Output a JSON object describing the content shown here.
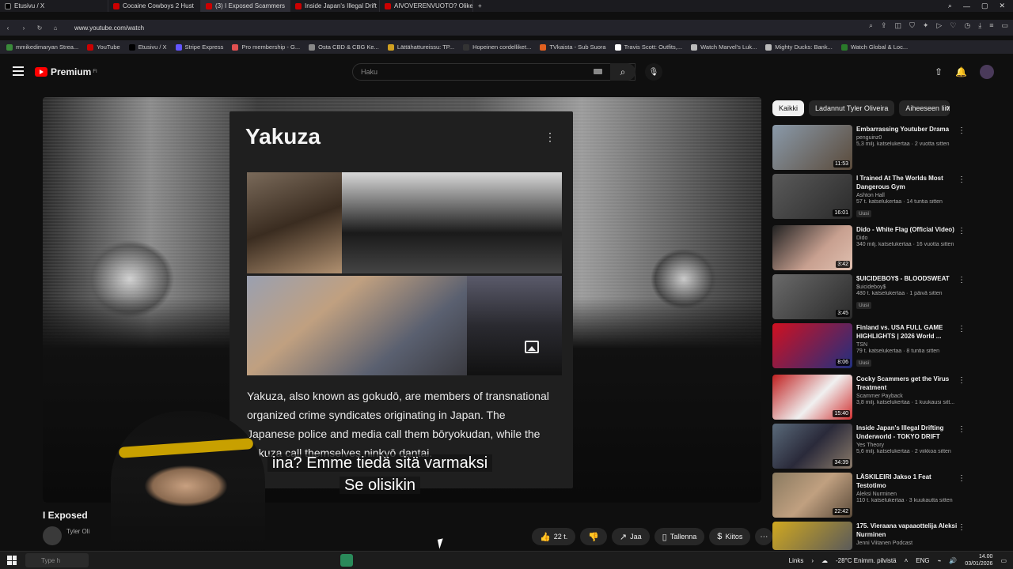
{
  "browser": {
    "tabs": [
      {
        "label": "Etusivu / X",
        "active": false
      },
      {
        "label": "Cocaine Cowboys 2 Hust",
        "active": false
      },
      {
        "label": "(3) I Exposed Scammers",
        "active": true
      },
      {
        "label": "Inside Japan's Illegal Drift",
        "active": false
      },
      {
        "label": "AIVOVERENVUOTO? Olike",
        "active": false
      }
    ],
    "url": "www.youtube.com/watch",
    "bookmarks": [
      "mmikedimaryan Strea...",
      "YouTube",
      "Etusivu / X",
      "Stripe Express",
      "Pro membership - G...",
      "Osta CBD & CBG Ke...",
      "Lättähattureissu: TP...",
      "Hopeinen cordelliket...",
      "TVkaista - Sub Suora",
      "Travis Scott: Outfits,...",
      "Watch Marvel's Luk...",
      "Mighty Ducks: Bank...",
      "Watch Global & Loc..."
    ]
  },
  "youtube": {
    "logo_text": "Premium",
    "logo_region": "FI",
    "search_placeholder": "Haku"
  },
  "video": {
    "title": "I Exposed",
    "channel": "Tyler Oli",
    "subtitle_lines": [
      "ina?  Emme tiedä sitä varmaksi",
      "Se olisikin"
    ],
    "knowledge_card": {
      "title": "Yakuza",
      "description": "Yakuza, also known as gokudō, are members of transnational organized crime syndicates originating in Japan. The Japanese police and media call them bōryokudan, while the yakuza call themselves ninkyō dantai."
    },
    "actions": {
      "likes": "22 t.",
      "share": "Jaa",
      "save": "Tallenna",
      "thanks": "Kiitos"
    }
  },
  "sidebar": {
    "chips": [
      "Kaikki",
      "Ladannut Tyler Oliveira",
      "Aiheeseen liittyvät"
    ],
    "recommendations": [
      {
        "title": "Embarrassing Youtuber Drama",
        "channel": "penguinz0",
        "meta": "5,3 milj. katselukertaa · 2 vuotta sitten",
        "duration": "11:53",
        "badge": "",
        "thumb": "#6a7a8a"
      },
      {
        "title": "I Trained At The Worlds Most Dangerous Gym",
        "channel": "Ashton Hall",
        "meta": "57 t. katselukertaa · 14 tuntia sitten",
        "duration": "16:01",
        "badge": "Uusi",
        "thumb": "#3a3a3a"
      },
      {
        "title": "Dido - White Flag (Official Video)",
        "channel": "Dido",
        "meta": "340 milj. katselukertaa · 16 vuotta sitten",
        "duration": "3:42",
        "badge": "",
        "thumb": "#8a6a6a"
      },
      {
        "title": "$UICIDEBOY$ - BLOODSWEAT",
        "channel": "$uicideboy$",
        "meta": "480 t. katselukertaa · 1 päivä sitten",
        "duration": "3:45",
        "badge": "Uusi",
        "thumb": "#4a4a4a"
      },
      {
        "title": "Finland vs. USA FULL GAME HIGHLIGHTS | 2026 World ...",
        "channel": "TSN",
        "meta": "79 t. katselukertaa · 8 tuntia sitten",
        "duration": "8:06",
        "badge": "Uusi",
        "thumb": "#c01020"
      },
      {
        "title": "Cocky Scammers get the Virus Treatment",
        "channel": "Scammer Payback",
        "meta": "3,8 milj. katselukertaa · 1 kuukausi sitt...",
        "duration": "15:40",
        "badge": "",
        "thumb": "#b03030"
      },
      {
        "title": "Inside Japan's Illegal Drifting Underworld - TOKYO DRIFT",
        "channel": "Yes Theory",
        "meta": "5,6 milj. katselukertaa · 2 viikkoa sitten",
        "duration": "34:39",
        "badge": "",
        "thumb": "#3a4a5a"
      },
      {
        "title": "LÄSKILEIRI Jakso 1 Feat Testotimo",
        "channel": "Aleksi Nurminen",
        "meta": "110 t. katselukertaa · 3 kuukautta sitten",
        "duration": "22:42",
        "badge": "",
        "thumb": "#7a6a50"
      },
      {
        "title": "175. Vieraana vapaaottelija Aleksi Nurminen",
        "channel": "Jenni Viitanen Podcast",
        "meta": "",
        "duration": "",
        "badge": "",
        "thumb": "#c8a020"
      }
    ]
  },
  "taskbar": {
    "search_placeholder": "Type h",
    "links_label": "Links",
    "weather": "-28°C  Enimm. pilvistä",
    "language": "ENG",
    "time": "14.00",
    "date": "03/01/2026"
  }
}
